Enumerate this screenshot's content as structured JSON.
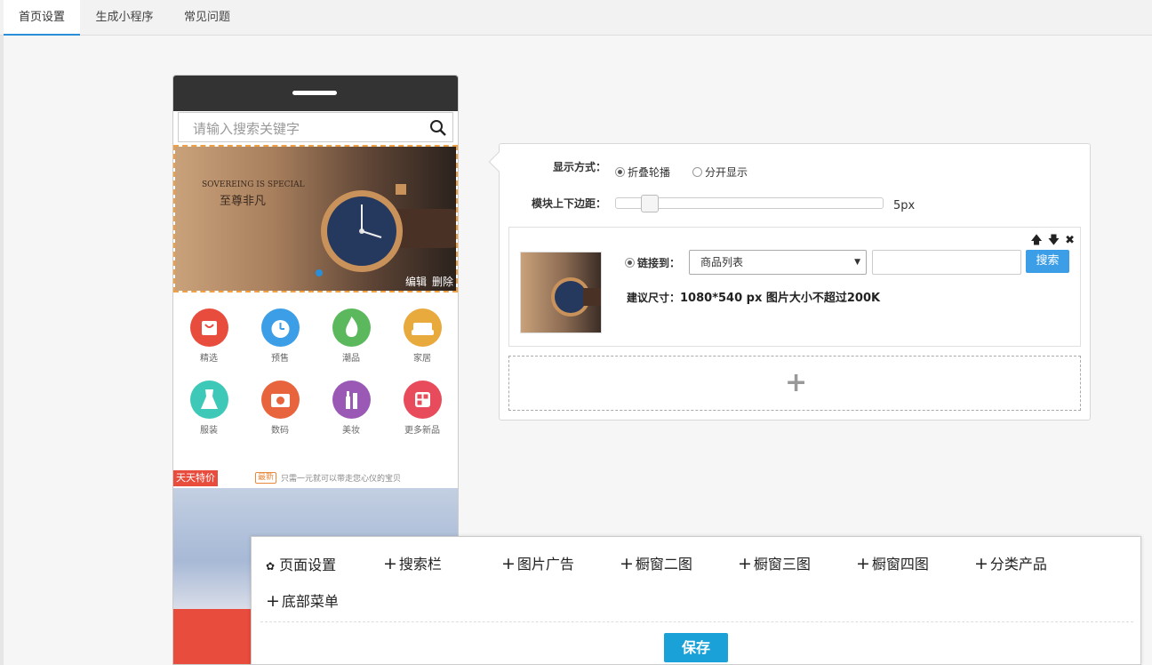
{
  "tabs": [
    {
      "label": "首页设置",
      "active": true
    },
    {
      "label": "生成小程序",
      "active": false
    },
    {
      "label": "常见问题",
      "active": false
    }
  ],
  "phone": {
    "search_placeholder": "请输入搜索关键字",
    "banner": {
      "tagline": "SOVEREING IS SPECIAL",
      "title": "至尊非凡",
      "edit_label": "编辑",
      "delete_label": "删除"
    },
    "categories": [
      {
        "label": "精选",
        "color": "#e84c3d",
        "icon": "shopping-bag-icon"
      },
      {
        "label": "预售",
        "color": "#3b9ee6",
        "icon": "alarm-clock-icon"
      },
      {
        "label": "潮品",
        "color": "#5cb85c",
        "icon": "flame-icon"
      },
      {
        "label": "家居",
        "color": "#e8a93d",
        "icon": "sofa-icon"
      },
      {
        "label": "服装",
        "color": "#3dc8b8",
        "icon": "dress-icon"
      },
      {
        "label": "数码",
        "color": "#e8643d",
        "icon": "camera-icon"
      },
      {
        "label": "美妆",
        "color": "#9b59b6",
        "icon": "cosmetics-icon"
      },
      {
        "label": "更多新品",
        "color": "#e84c5c",
        "icon": "grid-icon"
      }
    ],
    "deal": {
      "tag": "天天特价",
      "new_badge": "最新",
      "text": "只需一元就可以带走您心仪的宝贝"
    }
  },
  "config": {
    "display_label": "显示方式：",
    "display_options": [
      {
        "label": "折叠轮播",
        "checked": true
      },
      {
        "label": "分开显示",
        "checked": false
      }
    ],
    "margin_label": "模块上下边距：",
    "margin_value": "5px",
    "margin_level": 0.1,
    "item": {
      "link_label": "链接到：",
      "link_select": "商品列表",
      "search_button": "搜索",
      "size_label": "建议尺寸：",
      "size_value": "1080*540 px 图片大小不超过200K"
    }
  },
  "toolbar": {
    "items": [
      {
        "label": "页面设置",
        "icon": "gear-icon"
      },
      {
        "label": "搜索栏",
        "icon": "plus-icon"
      },
      {
        "label": "图片广告",
        "icon": "plus-icon"
      },
      {
        "label": "橱窗二图",
        "icon": "plus-icon"
      },
      {
        "label": "橱窗三图",
        "icon": "plus-icon"
      },
      {
        "label": "橱窗四图",
        "icon": "plus-icon"
      },
      {
        "label": "分类产品",
        "icon": "plus-icon"
      },
      {
        "label": "底部菜单",
        "icon": "plus-icon"
      }
    ],
    "save_label": "保存"
  },
  "colors": {
    "accent": "#2a8ed8",
    "save": "#1aa1d8",
    "deal": "#e84c3d"
  }
}
